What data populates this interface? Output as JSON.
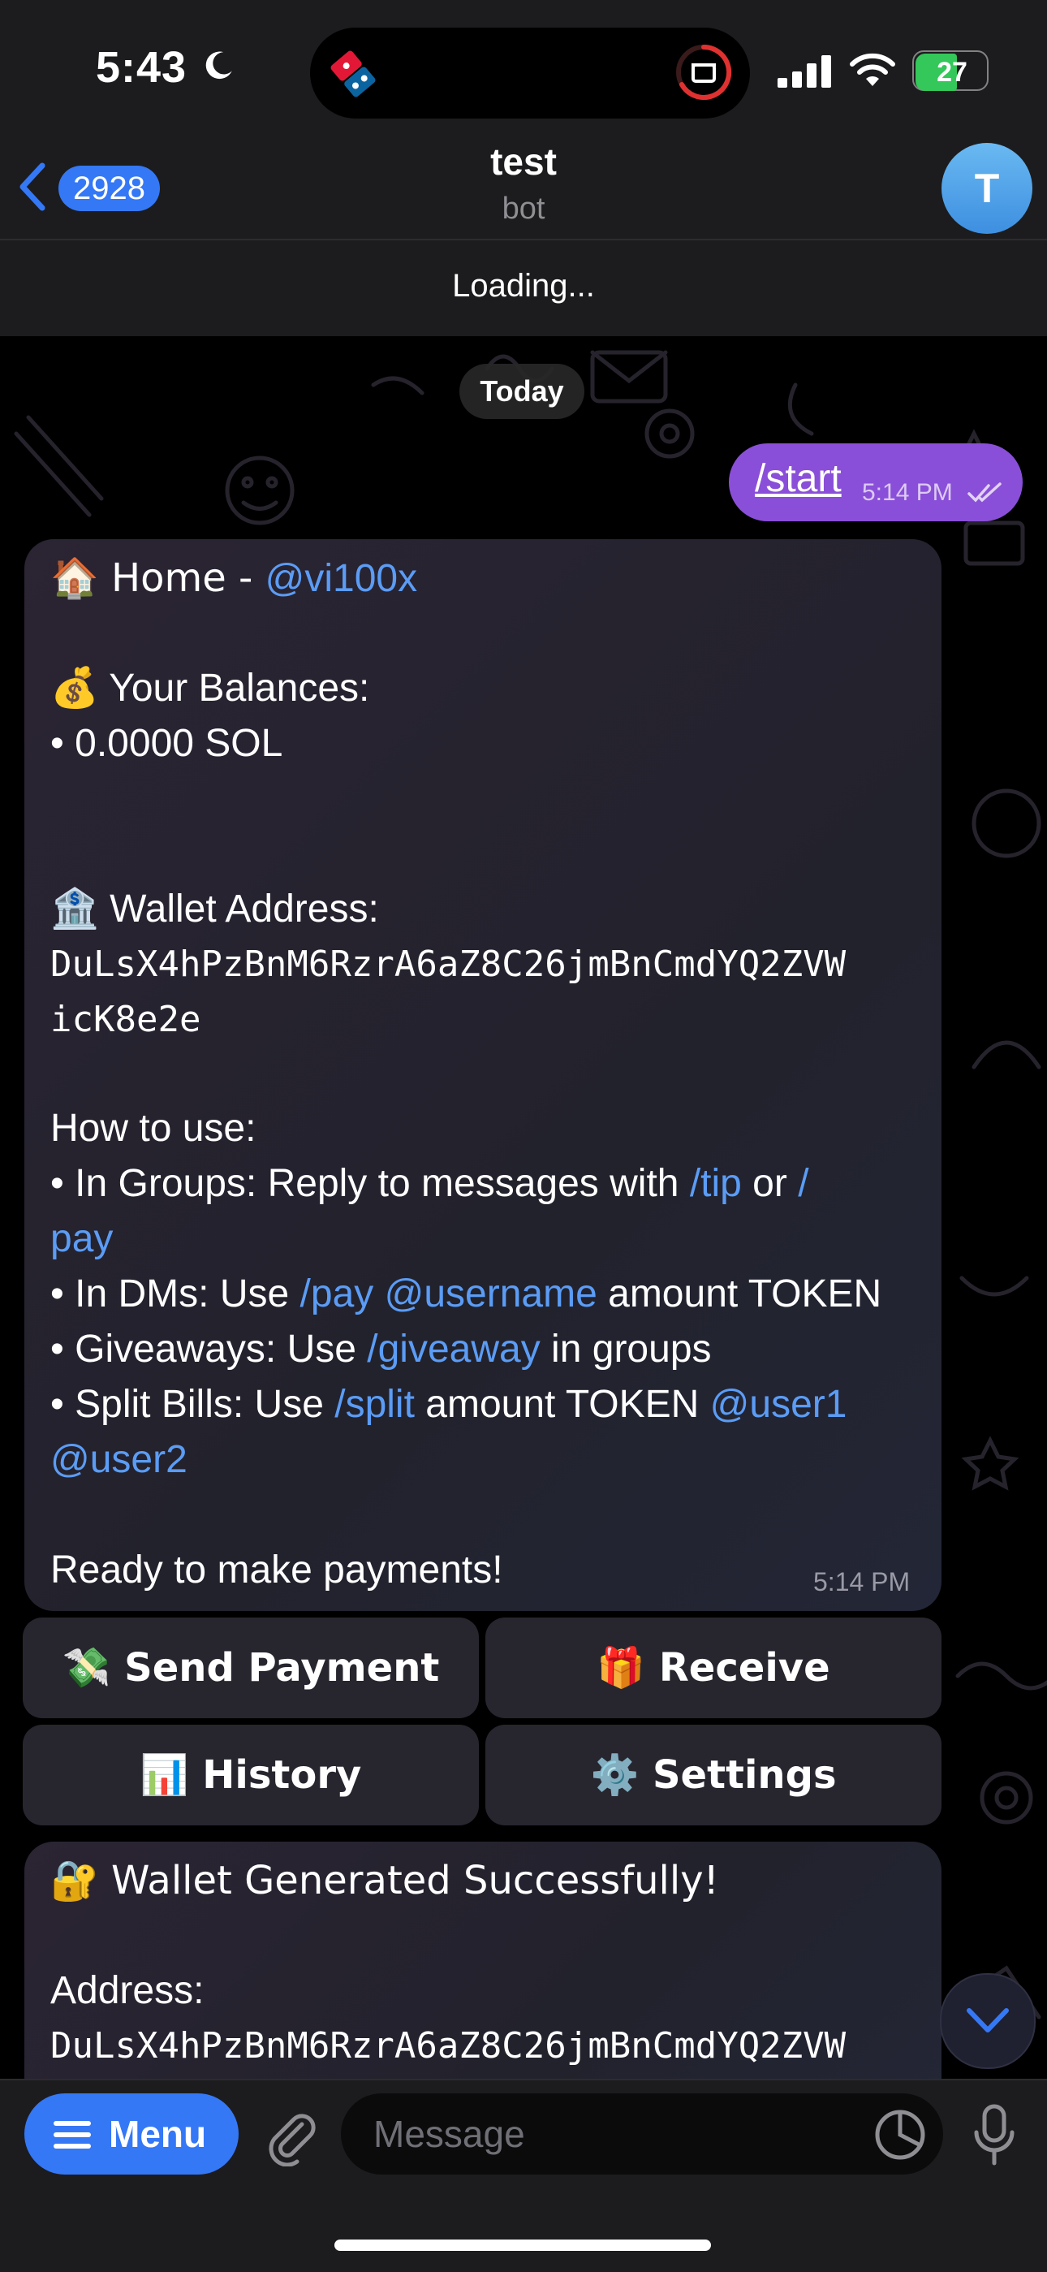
{
  "status_bar": {
    "time": "5:43",
    "battery": "27"
  },
  "header": {
    "back_count": "2928",
    "title": "test",
    "subtitle": "bot",
    "avatar_letter": "T"
  },
  "loading": "Loading...",
  "chat": {
    "date": "Today",
    "outgoing": {
      "text": "/start",
      "time": "5:14 PM"
    },
    "bot_message": {
      "home_prefix": "🏠 Home - ",
      "home_handle": "@vi100x",
      "balances_label": "💰 Your Balances:",
      "balance_line": "• 0.0000 SOL",
      "wallet_label": "🏦 Wallet Address:",
      "wallet_line1": "DuLsX4hPzBnM6RzrA6aZ8C26jmBnCmdYQ2ZVW",
      "wallet_line2": "icK8e2e",
      "how_to": "How to use:",
      "groups_prefix": "• In Groups: Reply to messages with ",
      "groups_tip": "/tip",
      "groups_or": " or ",
      "groups_slash": "/",
      "groups_pay": "pay",
      "dms_prefix": "• In DMs: Use ",
      "dms_pay": "/pay",
      "dms_user": "@username",
      "dms_suffix": " amount TOKEN",
      "give_prefix": "• Giveaways: Use ",
      "give_cmd": "/giveaway",
      "give_suffix": " in groups",
      "split_prefix": "• Split Bills: Use ",
      "split_cmd": "/split",
      "split_mid": " amount TOKEN ",
      "split_user1": "@user1",
      "split_user2": "@user2",
      "ready": "Ready to make payments!",
      "time": "5:14 PM"
    },
    "keyboard": {
      "send": "💸 Send Payment",
      "receive": "🎁 Receive",
      "history": "📊 History",
      "settings": "⚙️ Settings"
    },
    "bot_message2": {
      "title": "🔐 Wallet Generated Successfully!",
      "address_label": "Address:",
      "address": "DuLsX4hPzBnM6RzrA6aZ8C26jmBnCmdYQ2ZVW"
    }
  },
  "input": {
    "menu_label": "Menu",
    "placeholder": "Message"
  },
  "colors": {
    "accent": "#3478f6",
    "outgoing_bubble": "#8a4fd8",
    "link": "#5b9cf5",
    "battery": "#34c759"
  }
}
